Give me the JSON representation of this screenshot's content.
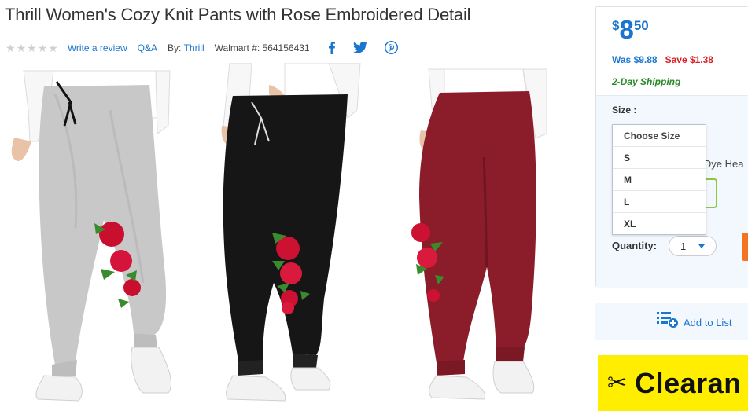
{
  "product": {
    "title": "Thrill Women's Cozy Knit Pants with Rose Embroidered Detail",
    "rating": 0,
    "write_review": "Write a review",
    "qa": "Q&A",
    "by_label": "By:",
    "brand": "Thrill",
    "walmart_no": "Walmart #: 564156431",
    "social_icons": [
      "facebook-icon",
      "twitter-icon",
      "pinterest-icon"
    ]
  },
  "pricing": {
    "currency": "$",
    "dollars": "8",
    "cents": "50",
    "was": "Was $9.88",
    "save": "Save $1.38",
    "shipping": "2-Day Shipping"
  },
  "options": {
    "size_label": "Size :",
    "size_options": [
      "Choose Size",
      "S",
      "M",
      "L",
      "XL"
    ],
    "color_text_partial": "e Dye Hea",
    "quantity_label": "Quantity:",
    "quantity_value": "1"
  },
  "actions": {
    "add_to_list": "Add to List",
    "clearance_banner": "Clearan"
  },
  "colors": {
    "accent_blue": "#1a75cf",
    "save_red": "#de1c24",
    "shipping_green": "#2a8a2a",
    "banner_yellow": "#ffee00",
    "cta_orange": "#f47321"
  }
}
